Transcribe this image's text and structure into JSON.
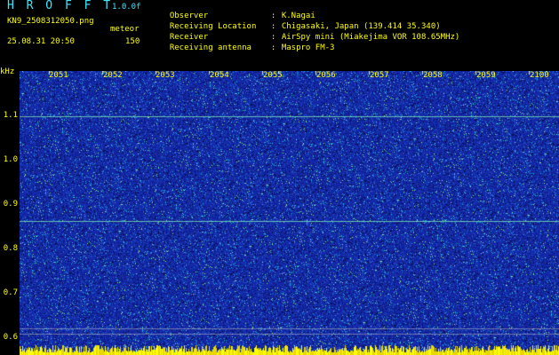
{
  "header": {
    "title": "H R O F F T",
    "version": "1.0.0f",
    "filename": "KN9_2508312050.png",
    "meteor_label": "meteor",
    "datetime": "25.08.31 20:50",
    "meteor_count": "150"
  },
  "info": [
    {
      "key": "Observer",
      "sep": ":",
      "value": "K.Nagai"
    },
    {
      "key": "Receiving Location",
      "sep": ":",
      "value": "Chigasaki, Japan (139.414 35.340)"
    },
    {
      "key": "Receiver",
      "sep": ":",
      "value": "AirSpy mini (Miakejima VOR 108.65MHz)"
    },
    {
      "key": "Receiving antenna",
      "sep": ":",
      "value": "Maspro FM-3"
    }
  ],
  "axis": {
    "y_unit": "kHz",
    "y_ticks": [
      "1.1",
      "1.0",
      "0.9",
      "0.8",
      "0.7",
      "0.6"
    ],
    "x_ticks": [
      "2051",
      "2052",
      "2053",
      "2054",
      "2055",
      "2056",
      "2057",
      "2058",
      "2059",
      "2100"
    ]
  },
  "colors": {
    "background": "#000000",
    "text": "#ffff00",
    "title": "#3ce8ff",
    "spectrogram_base": "#1a2fb0"
  }
}
